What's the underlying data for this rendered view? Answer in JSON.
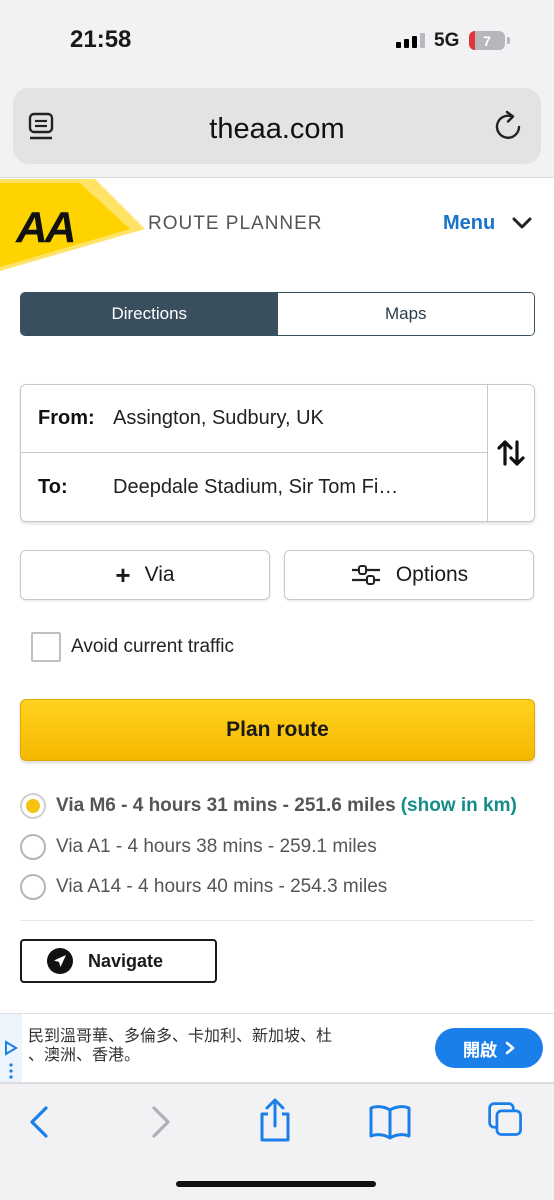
{
  "status": {
    "time": "21:58",
    "network": "5G",
    "battery": "7"
  },
  "browser": {
    "url": "theaa.com"
  },
  "header": {
    "section": "ROUTE PLANNER",
    "menu_label": "Menu"
  },
  "tabs": [
    {
      "label": "Directions",
      "active": true
    },
    {
      "label": "Maps",
      "active": false
    }
  ],
  "form": {
    "from_label": "From:",
    "from_value": "Assington, Sudbury, UK",
    "to_label": "To:",
    "to_value": "Deepdale Stadium, Sir Tom Fi…",
    "via_label": "Via",
    "options_label": "Options",
    "avoid_traffic_label": "Avoid current traffic",
    "avoid_traffic_checked": false,
    "plan_button": "Plan route"
  },
  "routes": [
    {
      "text": "Via M6 - 4 hours 31 mins - 251.6 miles",
      "selected": true,
      "link": "(show in km)"
    },
    {
      "text": "Via A1 - 4 hours 38 mins - 259.1 miles",
      "selected": false
    },
    {
      "text": "Via A14 - 4 hours 40 mins - 254.3 miles",
      "selected": false
    }
  ],
  "navigate_label": "Navigate",
  "ad": {
    "line1": "民到溫哥華、多倫多、卡加利、新加坡、杜",
    "line2": "、澳洲、香港。",
    "button": "開啟"
  },
  "colors": {
    "aa_yellow": "#ffd300",
    "tab_active": "#3a4f5e",
    "link_blue": "#1a73c9",
    "km_link": "#138c8a",
    "ios_blue": "#1a7fe8"
  },
  "icons": [
    "reader-icon",
    "reload-icon",
    "aa-logo",
    "chevron-down-icon",
    "swap-icon",
    "plus-icon",
    "sliders-icon",
    "navigate-arrow-icon",
    "back-icon",
    "forward-icon",
    "share-icon",
    "bookmarks-icon",
    "tabs-icon"
  ]
}
